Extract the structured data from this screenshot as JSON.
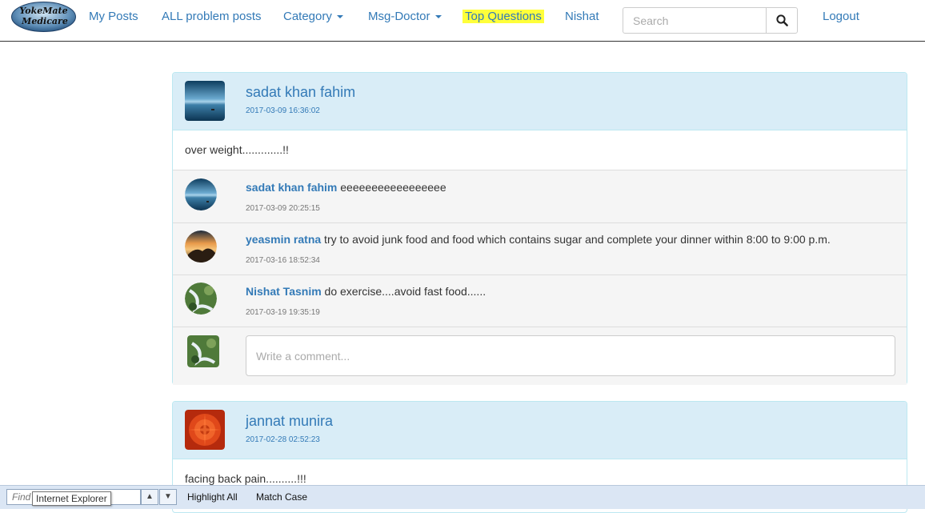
{
  "navbar": {
    "logo_line1": "YokeMate",
    "logo_line2": "Medicare",
    "my_posts": "My Posts",
    "all_problem_posts": "ALL problem posts",
    "category": "Category",
    "msg_doctor": "Msg-Doctor",
    "top_questions": "Top Questions",
    "user": "Nishat",
    "search_placeholder": "Search",
    "logout": "Logout"
  },
  "posts": [
    {
      "author": "sadat khan fahim",
      "time": "2017-03-09 16:36:02",
      "body": "over weight.............!!",
      "comments": [
        {
          "name": "sadat khan fahim",
          "text": " eeeeeeeeeeeeeeeee",
          "time": "2017-03-09 20:25:15"
        },
        {
          "name": "yeasmin ratna",
          "text": " try to avoid junk food and food which contains sugar and complete your dinner within 8:00 to 9:00 p.m.",
          "time": "2017-03-16 18:52:34"
        },
        {
          "name": "Nishat Tasnim",
          "text": " do exercise....avoid fast food......",
          "time": "2017-03-19 19:35:19"
        }
      ],
      "comment_placeholder": "Write a comment..."
    },
    {
      "author": "jannat munira",
      "time": "2017-02-28 02:52:23",
      "body": "facing back pain..........!!!"
    }
  ],
  "findbar": {
    "placeholder": "Find",
    "highlight_all": "Highlight All",
    "match_case": "Match Case",
    "tooltip": "Internet Explorer"
  },
  "colors": {
    "link": "#337ab7",
    "panel_heading": "#d9edf7",
    "highlight": "#ffff3a"
  }
}
